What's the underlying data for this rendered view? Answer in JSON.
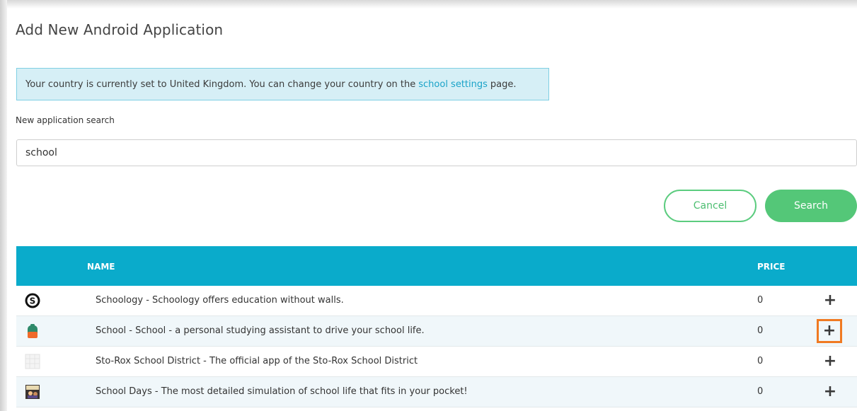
{
  "page": {
    "title": "Add New Android Application"
  },
  "notice": {
    "before": "Your country is currently set to United Kingdom. You can change your country on the",
    "link": "school settings",
    "after": "page."
  },
  "search": {
    "label": "New application search",
    "value": "school"
  },
  "buttons": {
    "cancel": "Cancel",
    "search": "Search"
  },
  "table": {
    "columns": {
      "name": "NAME",
      "price": "PRICE"
    },
    "rows": [
      {
        "name": "Schoology - Schoology offers education without walls.",
        "price": "0",
        "icon": "schoology-icon",
        "add": "+"
      },
      {
        "name": "School - School - a personal studying assistant to drive your school life.",
        "price": "0",
        "icon": "school-backpack-icon",
        "add": "+"
      },
      {
        "name": "Sto-Rox School District - The official app of the Sto-Rox School District",
        "price": "0",
        "icon": "sto-rox-placeholder-icon",
        "add": "+"
      },
      {
        "name": "School Days - The most detailed simulation of school life that fits in your pocket!",
        "price": "0",
        "icon": "school-days-icon",
        "add": "+"
      }
    ]
  },
  "colors": {
    "header": "#0aabcb",
    "button_green": "#54c778",
    "highlight": "#f07a22",
    "link": "#1aa3c8"
  }
}
